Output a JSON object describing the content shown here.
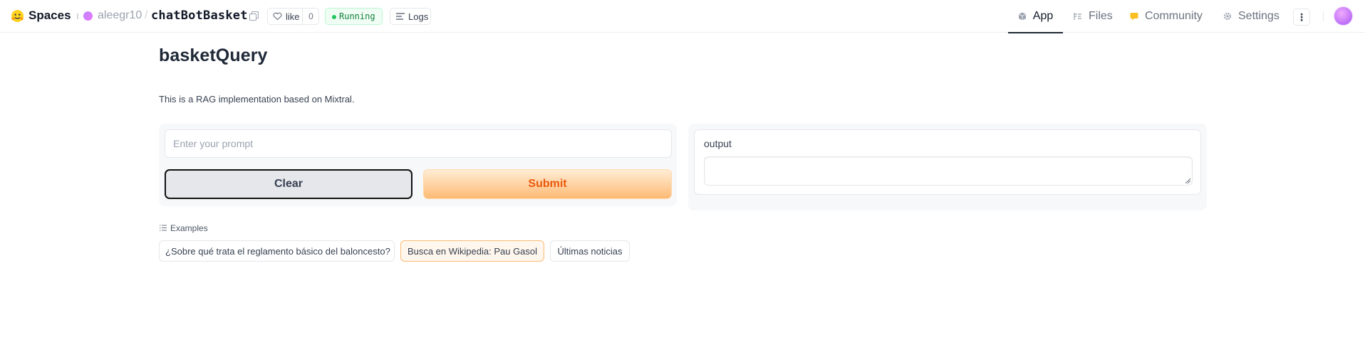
{
  "header": {
    "brand_label": "Spaces",
    "owner": "aleegr10",
    "separator": "/",
    "repo": "chatBotBasket",
    "like_label": "like",
    "like_count": "0",
    "status": "Running",
    "logs_label": "Logs",
    "tabs": [
      {
        "label": "App",
        "icon": "cube-icon",
        "active": true
      },
      {
        "label": "Files",
        "icon": "files-icon",
        "active": false
      },
      {
        "label": "Community",
        "icon": "community-icon",
        "active": false
      },
      {
        "label": "Settings",
        "icon": "gear-icon",
        "active": false
      }
    ],
    "more_label": "⋮"
  },
  "app": {
    "title": "basketQuery",
    "description": "This is a RAG implementation based on Mixtral.",
    "prompt": {
      "value": "",
      "placeholder": "Enter your prompt"
    },
    "clear_label": "Clear",
    "submit_label": "Submit",
    "output_label": "output",
    "output_value": ""
  },
  "examples": {
    "label": "Examples",
    "items": [
      "¿Sobre qué trata el reglamento básico del baloncesto?",
      "Busca en Wikipedia: Pau Gasol",
      "Últimas noticias"
    ]
  },
  "colors": {
    "accent": "#ea580c",
    "status_green": "#15803d",
    "submit_bg": "#fdba74",
    "active_tab_underline": "#1f2937"
  }
}
